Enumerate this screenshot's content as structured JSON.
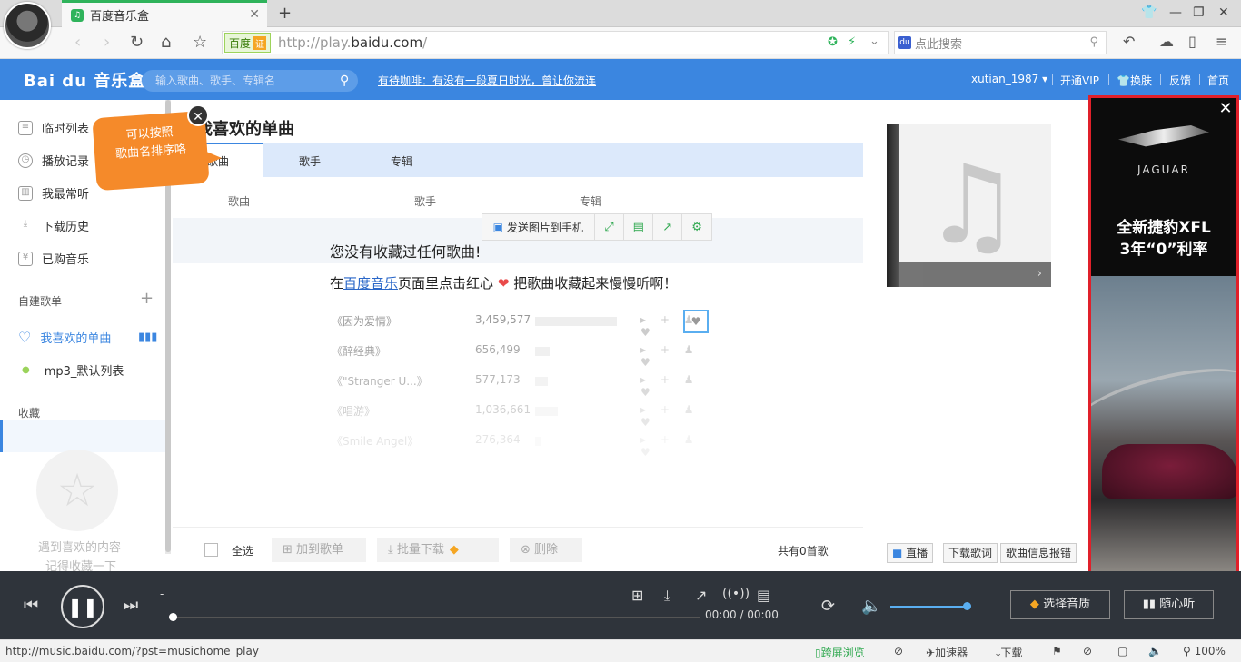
{
  "browser": {
    "tab_title": "百度音乐盒",
    "new_tab": "+",
    "cert_label": "百度",
    "cert_badge": "证",
    "url_prefix": "http://play.",
    "url_domain": "baidu.com",
    "url_suffix": "/",
    "search_placeholder": "点此搜索"
  },
  "site": {
    "logo": "Bai du 音乐盒",
    "search_placeholder": "输入歌曲、歌手、专辑名",
    "promo": "有待咖啡：有没有一段夏日时光，曾让你流连",
    "username": "xutian_1987",
    "links": [
      "开通VIP",
      "换肤",
      "反馈",
      "首页"
    ]
  },
  "sidebar": {
    "items": [
      {
        "label": "临时列表",
        "icon": "list-icon"
      },
      {
        "label": "播放记录",
        "icon": "clock-icon"
      },
      {
        "label": "我最常听",
        "icon": "chart-icon"
      },
      {
        "label": "下载历史",
        "icon": "download-icon"
      },
      {
        "label": "已购音乐",
        "icon": "yen-icon"
      }
    ],
    "section_custom": "自建歌单",
    "playlists": [
      {
        "label": "我喜欢的单曲"
      },
      {
        "label": "mp3_默认列表"
      }
    ],
    "section_fav": "收藏",
    "fav_empty_1": "遇到喜欢的内容",
    "fav_empty_2": "记得收藏一下"
  },
  "tooltip": {
    "line1": "可以按照",
    "line2": "歌曲名排序咯"
  },
  "main": {
    "title": "我喜欢的单曲",
    "tabs": [
      "歌曲",
      "歌手",
      "专辑"
    ],
    "columns": [
      "歌曲",
      "歌手",
      "专辑"
    ],
    "float_toolbar_label": "发送图片到手机",
    "empty_title": "您没有收藏过任何歌曲!",
    "empty_hint_pre": "在",
    "empty_hint_link": "百度音乐",
    "empty_hint_mid": "页面里点击红心",
    "empty_hint_post": "把歌曲收藏起来慢慢听啊！",
    "example_songs": [
      {
        "name": "《因为爱情》",
        "count": "3,459,577",
        "bar": 0.78
      },
      {
        "name": "《醉经典》",
        "count": "656,499",
        "bar": 0.14
      },
      {
        "name": "《\"Stranger U...》",
        "count": "577,173",
        "bar": 0.12
      },
      {
        "name": "《唱游》",
        "count": "1,036,661",
        "bar": 0.22
      },
      {
        "name": "《Smile Angel》",
        "count": "276,364",
        "bar": 0.06
      }
    ],
    "select_all": "全选",
    "btn_add": "加到歌单",
    "btn_download": "批量下载",
    "btn_delete": "删除",
    "total": "共有0首歌"
  },
  "right": {
    "btn_live": "直播",
    "btn_lyrics": "下载歌词",
    "btn_report": "歌曲信息报错"
  },
  "ad": {
    "brand": "JAGUAR",
    "headline1": "全新捷豹XFL",
    "headline2": "3年“0”利率"
  },
  "player": {
    "track": "-",
    "time": "00:00 / 00:00",
    "btn_quality": "选择音质",
    "btn_random": "随心听",
    "volume": 0.85,
    "progress": 0
  },
  "statusbar": {
    "url": "http://music.baidu.com/?pst=musichome_play",
    "cross_screen": "跨屏浏览",
    "accelerator": "加速器",
    "download": "下载",
    "zoom": "100%"
  }
}
